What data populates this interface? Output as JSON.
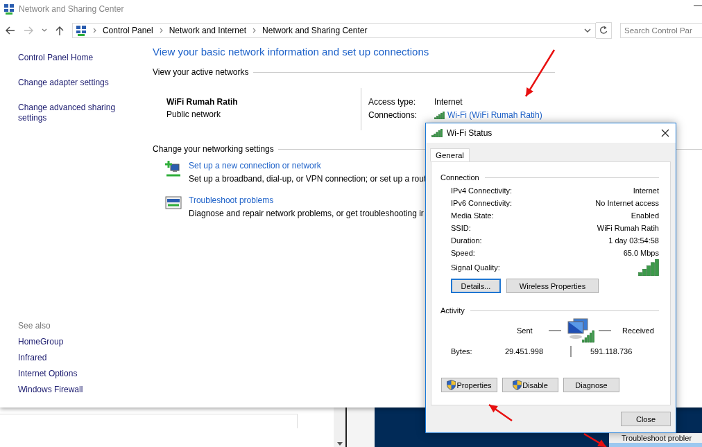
{
  "window": {
    "title": "Network and Sharing Center"
  },
  "address_bar": {
    "breadcrumbs": [
      "Control Panel",
      "Network and Internet",
      "Network and Sharing Center"
    ]
  },
  "search": {
    "placeholder": "Search Control Par"
  },
  "sidebar": {
    "links": [
      "Control Panel Home",
      "Change adapter settings",
      "Change advanced sharing settings"
    ],
    "see_also_label": "See also",
    "see_also": [
      "HomeGroup",
      "Infrared",
      "Internet Options",
      "Windows Firewall"
    ]
  },
  "main": {
    "heading": "View your basic network information and set up connections",
    "active_networks_label": "View your active networks",
    "network_name": "WiFi Rumah Ratih",
    "network_type": "Public network",
    "access_type_label": "Access type:",
    "access_type": "Internet",
    "connections_label": "Connections:",
    "connection": "Wi-Fi (WiFi Rumah Ratih)"
  },
  "settings": {
    "label": "Change your networking settings",
    "tasks": [
      {
        "kind": "new-connection",
        "title": "Set up a new connection or network",
        "description": "Set up a broadband, dial-up, or VPN connection; or set up a rout"
      },
      {
        "kind": "troubleshoot",
        "title": "Troubleshoot problems",
        "description": "Diagnose and repair network problems, or get troubleshooting ir"
      }
    ]
  },
  "dialog": {
    "title": "Wi-Fi Status",
    "tabs": [
      {
        "label": "General",
        "selected": true
      }
    ],
    "connection_label": "Connection",
    "rows": [
      {
        "label": "IPv4 Connectivity:",
        "value": "Internet"
      },
      {
        "label": "IPv6 Connectivity:",
        "value": "No Internet access"
      },
      {
        "label": "Media State:",
        "value": "Enabled"
      },
      {
        "label": "SSID:",
        "value": "WiFi Rumah Ratih"
      },
      {
        "label": "Duration:",
        "value": "1 day 03:54:58"
      },
      {
        "label": "Speed:",
        "value": "65.0 Mbps"
      }
    ],
    "signal_label": "Signal Quality:",
    "connection_buttons": [
      {
        "label": "Details...",
        "focused": true
      },
      {
        "label": "Wireless Properties",
        "focused": false
      }
    ],
    "activity_label": "Activity",
    "sent_label": "Sent",
    "received_label": "Received",
    "bytes_label": "Bytes:",
    "bytes_sent": "29.451.998",
    "bytes_received": "591.118.736",
    "action_buttons": [
      {
        "label": "Properties",
        "shield": true
      },
      {
        "label": "Disable",
        "shield": true
      },
      {
        "label": "Diagnose",
        "shield": false
      }
    ],
    "close_button": "Close"
  },
  "background": {
    "panel_text": "Troubleshoot probler"
  }
}
